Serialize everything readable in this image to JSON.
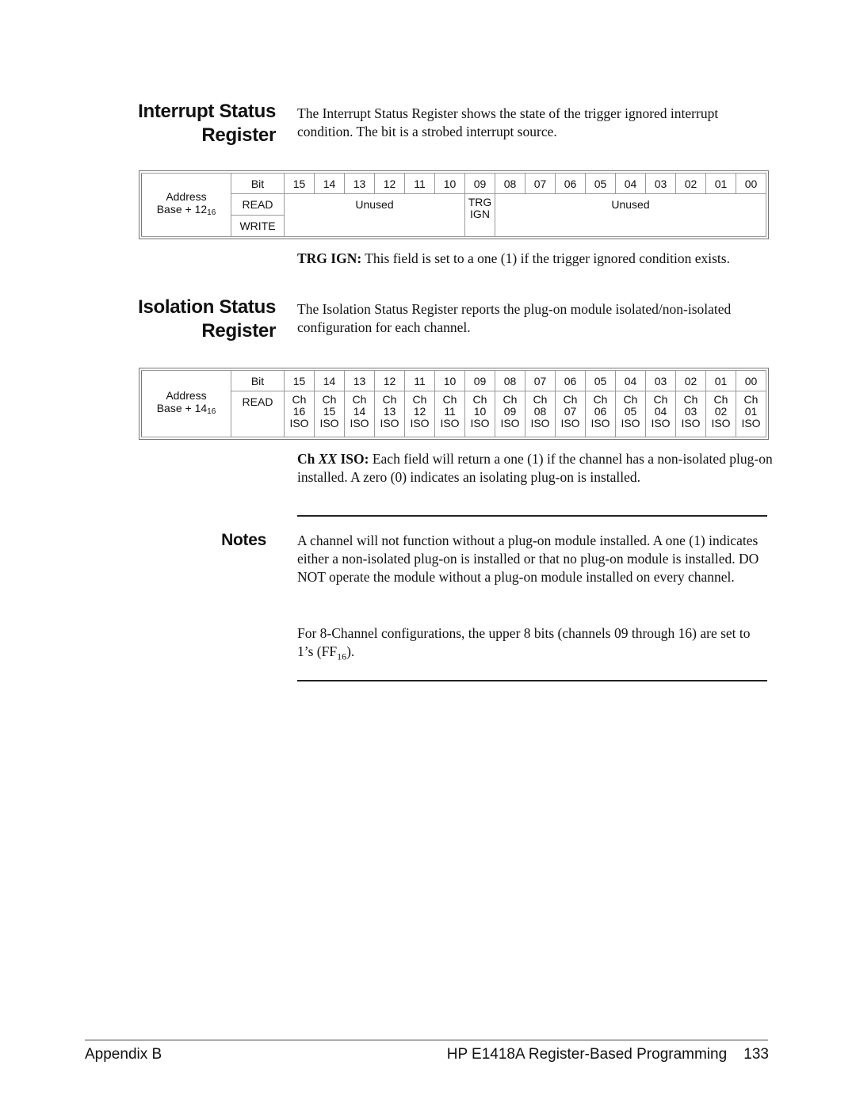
{
  "interrupt_section": {
    "heading_line1": "Interrupt Status",
    "heading_line2": "Register",
    "intro": "The Interrupt Status Register shows the state of the trigger ignored interrupt condition.  The bit is a strobed interrupt source.",
    "table": {
      "address_label": "Address",
      "address_base": "Base + 12",
      "address_subscript": "16",
      "bit_label": "Bit",
      "read_label": "READ",
      "write_label": "WRITE",
      "bits": [
        "15",
        "14",
        "13",
        "12",
        "11",
        "10",
        "09",
        "08",
        "07",
        "06",
        "05",
        "04",
        "03",
        "02",
        "01",
        "00"
      ],
      "read_fields": {
        "upper_unused": "Unused",
        "bit09_line1": "TRG",
        "bit09_line2": "IGN",
        "lower_unused": "Unused"
      }
    },
    "field_desc_term": "TRG IGN:",
    "field_desc_text": " This field is set to a one (1) if the trigger ignored condition exists."
  },
  "isolation_section": {
    "heading_line1": "Isolation Status",
    "heading_line2": "Register",
    "intro": "The Isolation Status Register reports the plug-on module isolated/non-isolated configuration for each channel.",
    "table": {
      "address_label": "Address",
      "address_base": "Base + 14",
      "address_subscript": "16",
      "bit_label": "Bit",
      "read_label": "READ",
      "bits": [
        "15",
        "14",
        "13",
        "12",
        "11",
        "10",
        "09",
        "08",
        "07",
        "06",
        "05",
        "04",
        "03",
        "02",
        "01",
        "00"
      ],
      "read_fields": [
        {
          "l1": "Ch",
          "l2": "16",
          "l3": "ISO"
        },
        {
          "l1": "Ch",
          "l2": "15",
          "l3": "ISO"
        },
        {
          "l1": "Ch",
          "l2": "14",
          "l3": "ISO"
        },
        {
          "l1": "Ch",
          "l2": "13",
          "l3": "ISO"
        },
        {
          "l1": "Ch",
          "l2": "12",
          "l3": "ISO"
        },
        {
          "l1": "Ch",
          "l2": "11",
          "l3": "ISO"
        },
        {
          "l1": "Ch",
          "l2": "10",
          "l3": "ISO"
        },
        {
          "l1": "Ch",
          "l2": "09",
          "l3": "ISO"
        },
        {
          "l1": "Ch",
          "l2": "08",
          "l3": "ISO"
        },
        {
          "l1": "Ch",
          "l2": "07",
          "l3": "ISO"
        },
        {
          "l1": "Ch",
          "l2": "06",
          "l3": "ISO"
        },
        {
          "l1": "Ch",
          "l2": "05",
          "l3": "ISO"
        },
        {
          "l1": "Ch",
          "l2": "04",
          "l3": "ISO"
        },
        {
          "l1": "Ch",
          "l2": "03",
          "l3": "ISO"
        },
        {
          "l1": "Ch",
          "l2": "02",
          "l3": "ISO"
        },
        {
          "l1": "Ch",
          "l2": "01",
          "l3": "ISO"
        }
      ]
    },
    "field_desc_term_a": "Ch ",
    "field_desc_term_italic": "XX",
    "field_desc_term_b": " ISO:",
    "field_desc_text": " Each field will return a one (1) if the channel has a non-isolated plug-on installed.  A zero (0) indicates an isolating plug-on is installed."
  },
  "notes": {
    "heading": "Notes",
    "paragraph1": "A channel will not function without a plug-on module installed.  A one (1) indicates either a non-isolated plug-on is installed or that no plug-on module is installed.  DO NOT operate the module without a plug-on module installed on every channel.",
    "paragraph2_text": "For 8-Channel configurations, the upper 8 bits (channels 09 through 16) are set to 1’s (FF",
    "paragraph2_subscript": "16",
    "paragraph2_end": ")."
  },
  "footer": {
    "left": "Appendix  B",
    "title": "HP E1418A Register-Based Programming",
    "page_number": "133"
  }
}
